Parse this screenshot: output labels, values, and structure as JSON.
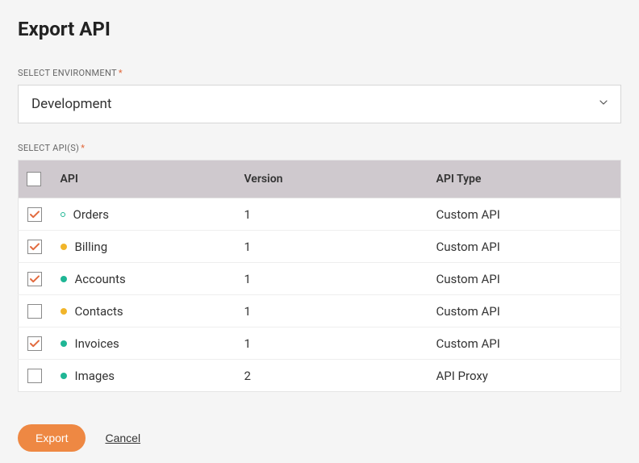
{
  "title": "Export API",
  "environment": {
    "label": "SELECT ENVIRONMENT",
    "value": "Development"
  },
  "apis": {
    "label": "SELECT API(S)",
    "headers": {
      "api": "API",
      "version": "Version",
      "type": "API Type"
    },
    "rows": [
      {
        "checked": true,
        "status_color": "#1fb695",
        "status_hollow": true,
        "name": "Orders",
        "version": "1",
        "type": "Custom API"
      },
      {
        "checked": true,
        "status_color": "#f1b52a",
        "status_hollow": false,
        "name": "Billing",
        "version": "1",
        "type": "Custom API"
      },
      {
        "checked": true,
        "status_color": "#1fb695",
        "status_hollow": false,
        "name": "Accounts",
        "version": "1",
        "type": "Custom API"
      },
      {
        "checked": false,
        "status_color": "#f1b52a",
        "status_hollow": false,
        "name": "Contacts",
        "version": "1",
        "type": "Custom API"
      },
      {
        "checked": true,
        "status_color": "#1fb695",
        "status_hollow": false,
        "name": "Invoices",
        "version": "1",
        "type": "Custom API"
      },
      {
        "checked": false,
        "status_color": "#1fb695",
        "status_hollow": false,
        "name": "Images",
        "version": "2",
        "type": "API Proxy"
      }
    ]
  },
  "actions": {
    "export": "Export",
    "cancel": "Cancel"
  },
  "colors": {
    "accent": "#ee8843",
    "check": "#e26a3e"
  }
}
